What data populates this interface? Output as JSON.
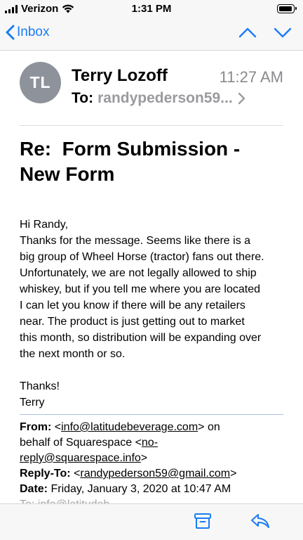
{
  "status_bar": {
    "carrier": "Verizon",
    "time": "1:31 PM",
    "icons": [
      "signal-icon",
      "wifi-icon",
      "battery-icon"
    ]
  },
  "nav": {
    "back_label": "Inbox",
    "icons": [
      "chevron-left-icon",
      "chevron-up-icon",
      "chevron-down-icon"
    ]
  },
  "message": {
    "avatar_initials": "TL",
    "sender": "Terry Lozoff",
    "time": "11:27 AM",
    "to_label": "To:",
    "to_value": "randypederson59...",
    "subject_line1": "Re:  Form Submission -",
    "subject_line2": "New Form",
    "body": {
      "greeting": "Hi Randy,",
      "lines": [
        "Thanks for the message. Seems like there is a",
        "big group of Wheel Horse (tractor) fans out there.",
        "Unfortunately, we are not legally allowed to ship",
        "whiskey, but if you tell me where you are located",
        "I can let you know if there will be any retailers",
        "near. The product is just getting out to market",
        "this month, so distribution will be expanding over",
        "the next month or so."
      ],
      "signoff": "Thanks!",
      "signature": "Terry"
    },
    "quoted": {
      "from_label": "From:",
      "from_email": "info@latitudebeverage.com",
      "from_suffix": " on",
      "behalf_text": "behalf of Squarespace <",
      "noreply_part1": "no-",
      "noreply_part2": "reply@squarespace.info",
      "replyto_label": "Reply-To:",
      "replyto_email": "randypederson59@gmail.com",
      "date_label": "Date:",
      "date_value": "Friday, January 3, 2020 at 10:47 AM",
      "peek_text": "To: info@latitudeb..."
    }
  },
  "toolbar": {
    "icons": [
      "archive-icon",
      "reply-icon"
    ]
  },
  "colors": {
    "accent": "#1a7cf5",
    "avatar": "#8e939b",
    "muted": "#8a8a8e",
    "quote_rule": "#a8c3e6"
  }
}
